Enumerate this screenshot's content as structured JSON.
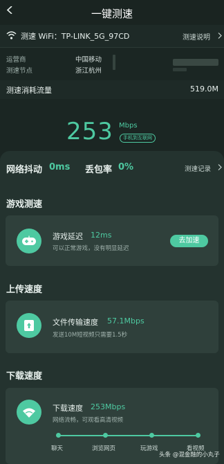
{
  "header": {
    "title": "一键测速"
  },
  "wifi": {
    "label": "测速 WiFi：",
    "ssid": "TP-LINK_5G_97CD",
    "help": "测速说明"
  },
  "info": [
    {
      "key": "运营商",
      "value": "中国移动"
    },
    {
      "key": "测速节点",
      "value": "浙江杭州"
    }
  ],
  "traffic": {
    "label": "测速消耗流量",
    "value": "519.0M"
  },
  "speed": {
    "value": "253",
    "unit": "Mbps",
    "badge": "手机到互联网"
  },
  "stats": {
    "jitter_label": "网络抖动",
    "jitter_value": "0ms",
    "loss_label": "丢包率",
    "loss_value": "0%",
    "record": "测速记录"
  },
  "game": {
    "title": "游戏测速",
    "label": "游戏延迟",
    "value": "12ms",
    "desc": "可以正常游戏，没有明显延迟",
    "button": "去加速"
  },
  "upload": {
    "title": "上传速度",
    "label": "文件传输速度",
    "value": "57.1Mbps",
    "desc": "发送10M短视频只需要1.5秒"
  },
  "download": {
    "title": "下载速度",
    "label": "下载速度",
    "value": "253Mbps",
    "desc": "网络流畅，可观看高清视频",
    "scale": [
      "聊天",
      "浏览网页",
      "玩游戏",
      "看视频"
    ]
  },
  "watermark": "头条 @混金融的小丸子",
  "colors": {
    "accent": "#4ec9a1",
    "background": "#1b2623",
    "panel": "#24332f",
    "card": "#2f403b"
  }
}
